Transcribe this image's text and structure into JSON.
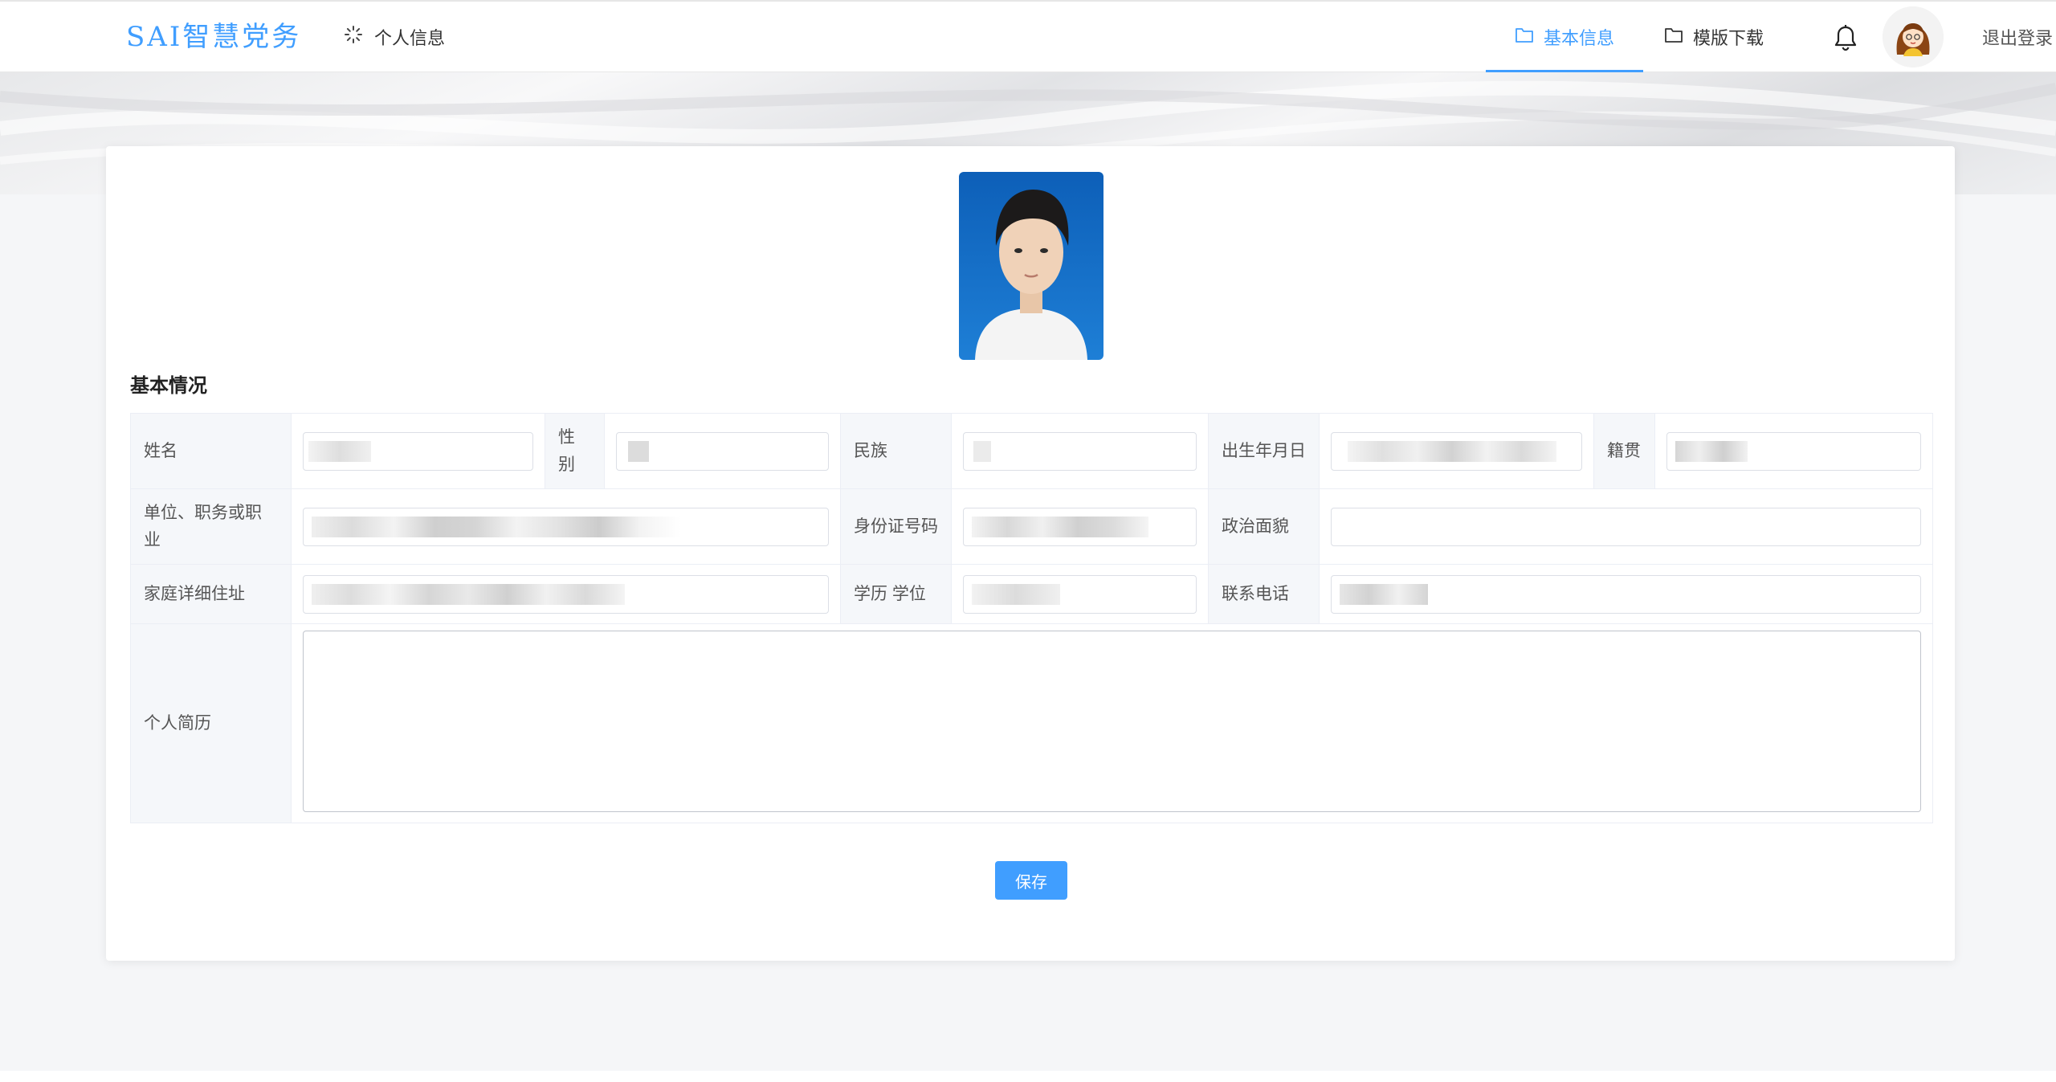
{
  "header": {
    "brand": "SAI智慧党务",
    "personal_info": "个人信息",
    "tabs": [
      {
        "label": "基本信息",
        "active": true
      },
      {
        "label": "模版下载",
        "active": false
      }
    ],
    "logout": "退出登录"
  },
  "icons": {
    "personal": "loading-spinner-icon",
    "tab_basic": "folder-icon",
    "tab_download": "folder-icon",
    "notification": "bell-icon",
    "avatar": "cartoon-girl-avatar"
  },
  "colors": {
    "accent": "#409eff",
    "label_bg": "#f5f7fa",
    "page_bg": "#f5f6f8"
  },
  "profile": {
    "section_title": "基本情况",
    "labels": {
      "name": "姓名",
      "gender": "性别",
      "ethnicity": "民族",
      "birth": "出生年月日",
      "native_place": "籍贯",
      "employer_position": "单位、职务或职业",
      "id_number": "身份证号码",
      "political_status": "政治面貌",
      "home_address": "家庭详细住址",
      "education_degree": "学历 学位",
      "phone": "联系电话",
      "resume": "个人简历"
    },
    "values": {
      "name": "",
      "gender": "",
      "ethnicity": "",
      "birth": "",
      "native_place": "",
      "employer_position": "",
      "id_number": "",
      "political_status": "",
      "home_address": "",
      "education_degree": "",
      "phone": "",
      "resume": ""
    },
    "save_label": "保存"
  }
}
